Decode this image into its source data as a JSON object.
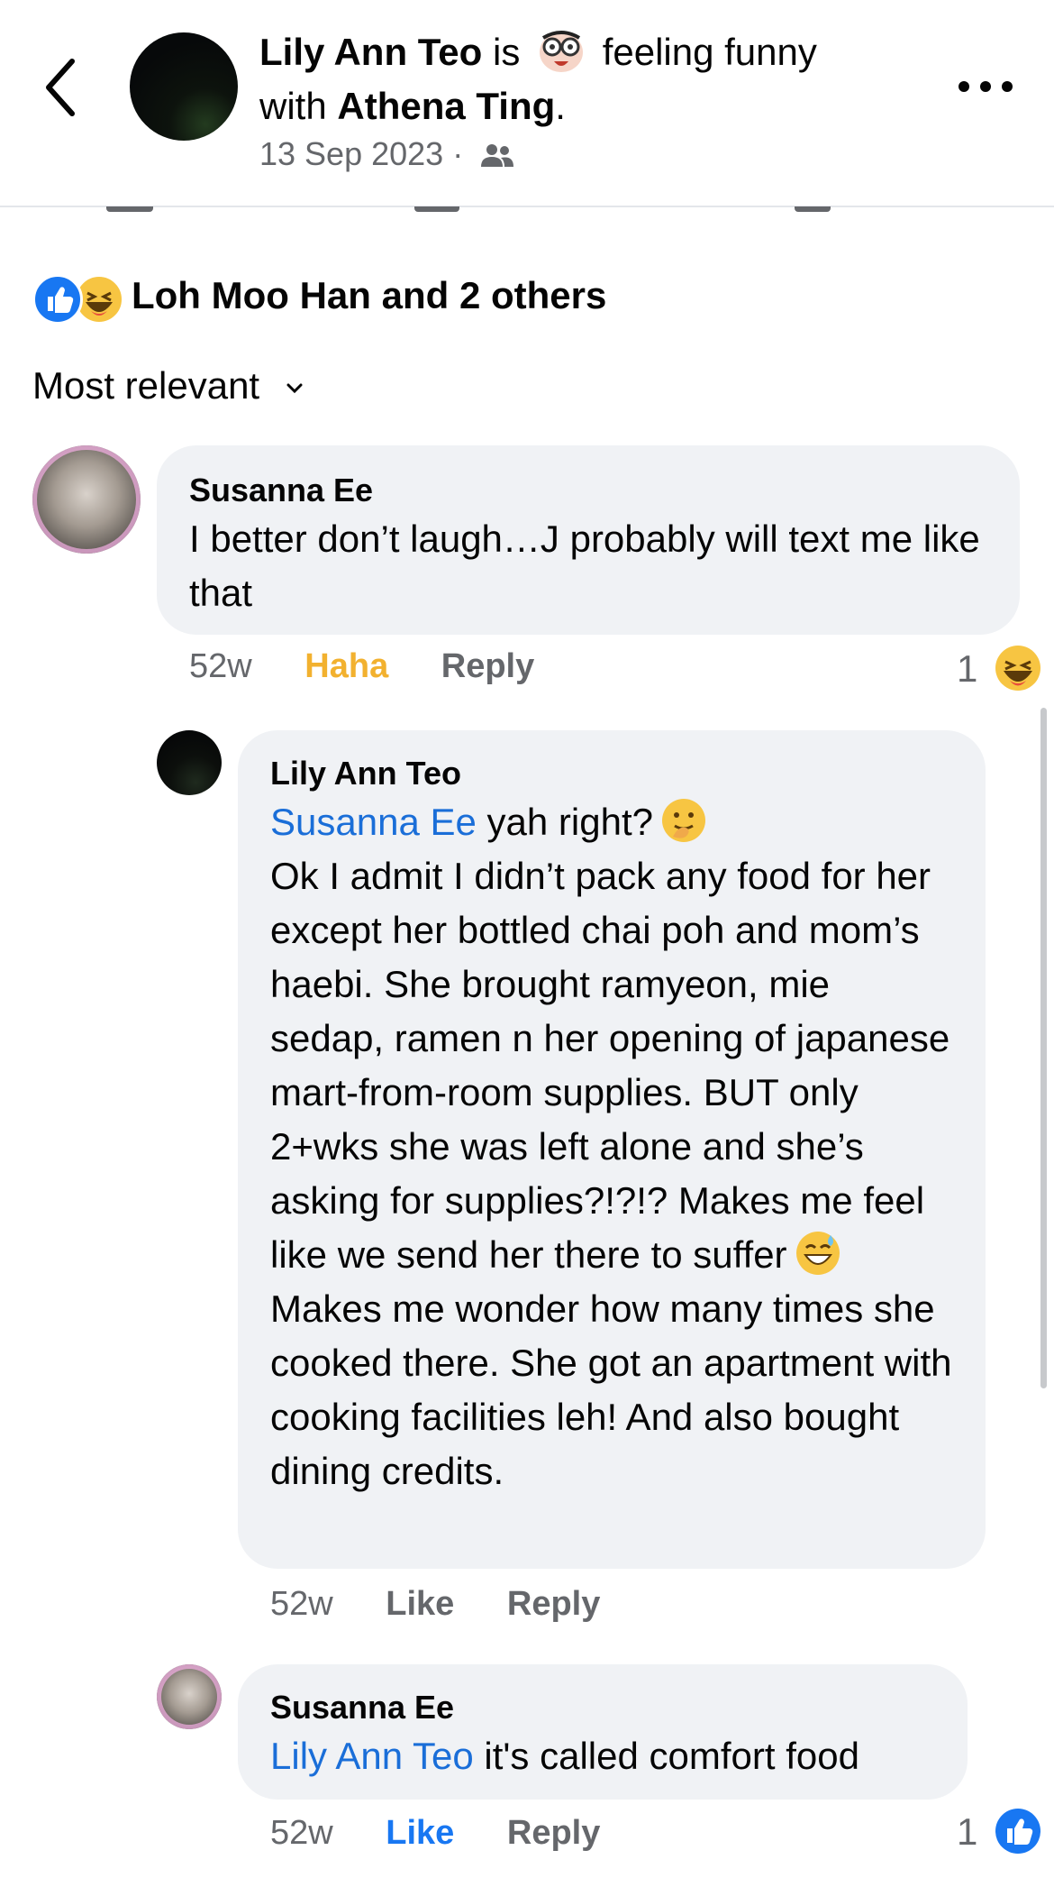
{
  "header": {
    "author": "Lily Ann Teo",
    "is_text": "is",
    "feeling": "feeling funny",
    "with_text": "with",
    "tagged": "Athena Ting",
    "period": ".",
    "date": "13 Sep 2023 ·",
    "feeling_icon": "nerd-face-icon",
    "audience_icon": "friends-icon"
  },
  "reactions": {
    "text": "Loh Moo Han and 2 others",
    "icons": [
      "like-icon",
      "haha-icon"
    ]
  },
  "sort": {
    "label": "Most relevant"
  },
  "comments": [
    {
      "author": "Susanna Ee",
      "text": "I better don’t laugh…J probably will text me like that",
      "time": "52w",
      "reaction_action": "Haha",
      "reply": "Reply",
      "reaction_count": "1",
      "reaction_icon": "haha-icon"
    },
    {
      "author": "Lily Ann Teo",
      "mention": "Susanna Ee",
      "line1": " yah right?",
      "body1": "Ok I admit I didn’t pack any food for her except her bottled chai poh and mom’s haebi. She brought ramyeon, mie sedap, ramen n her opening of japanese mart-from-room supplies. BUT only 2+wks she was left alone and she’s asking for supplies?!?!? Makes me feel like we send her there to suffer",
      "body2": "Makes me wonder how many times she cooked there. She got an apartment with cooking facilities leh! And also bought dining credits.",
      "time": "52w",
      "like": "Like",
      "reply": "Reply"
    },
    {
      "author": "Susanna Ee",
      "mention": "Lily Ann Teo",
      "text": " it's called comfort food",
      "time": "52w",
      "like": "Like",
      "reply": "Reply",
      "reaction_count": "1",
      "reaction_icon": "like-icon"
    }
  ],
  "colors": {
    "mention": "#1a6ed8",
    "like_blue": "#1877f2",
    "haha_yellow": "#f2b12f",
    "bubble": "#f0f2f5",
    "muted": "#65676b"
  }
}
